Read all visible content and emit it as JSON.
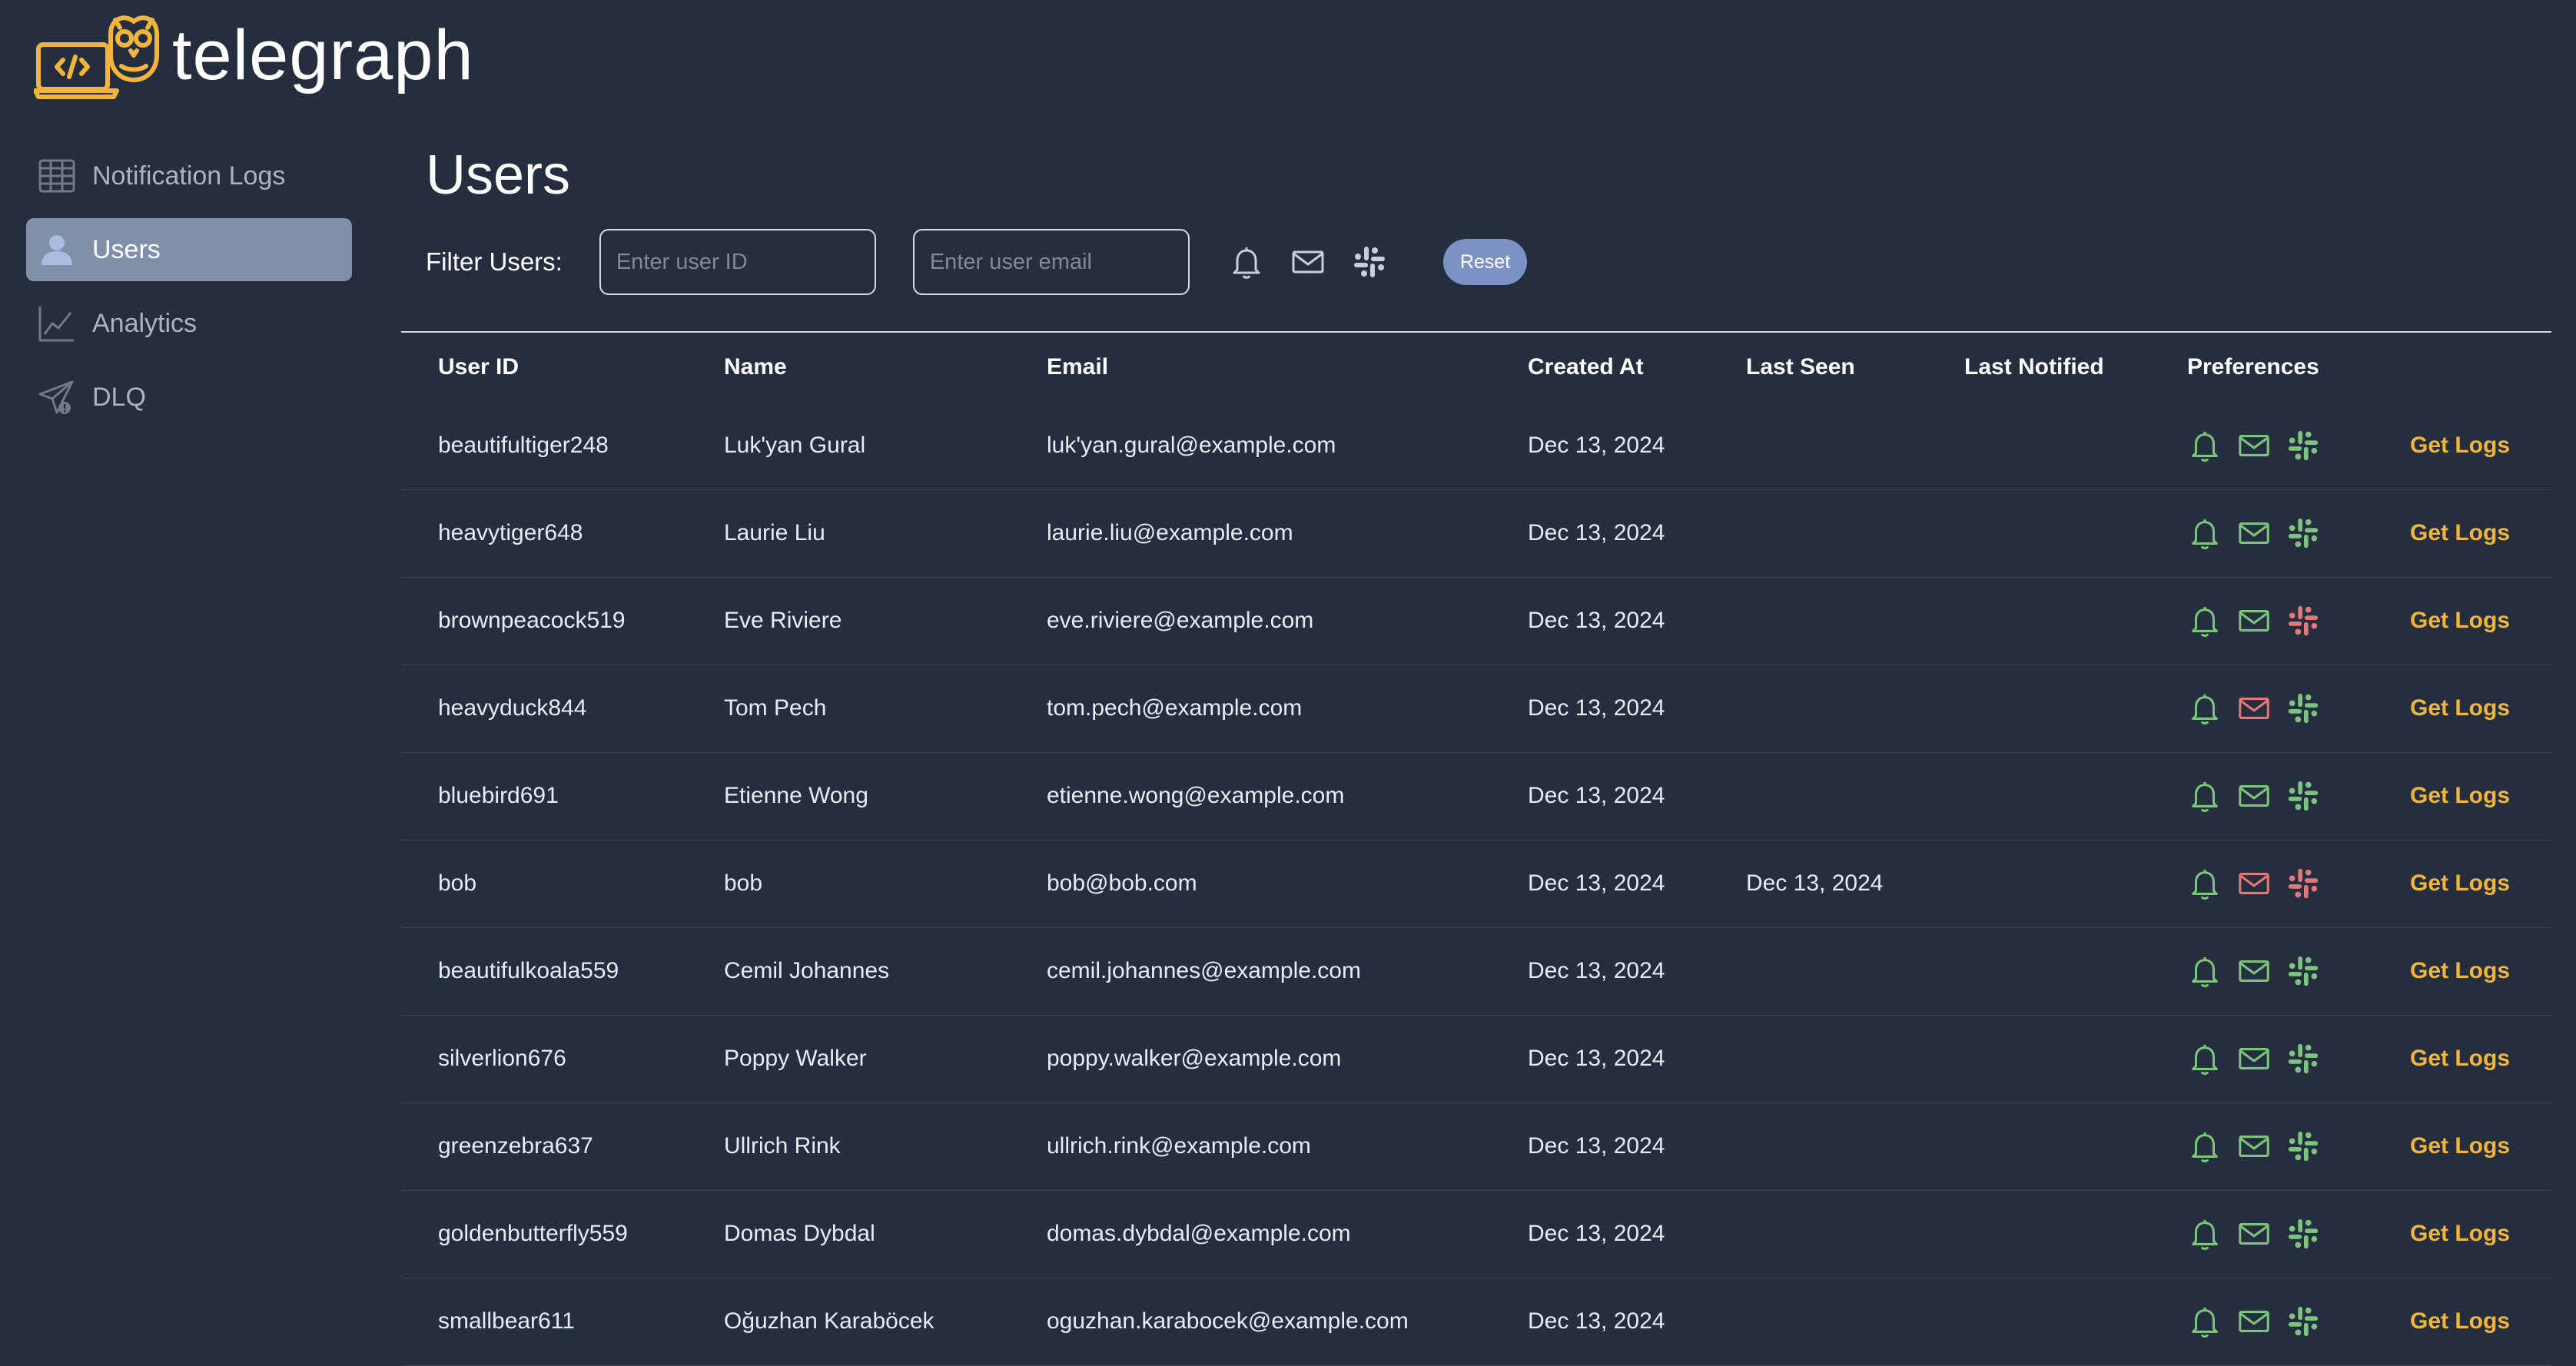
{
  "app": {
    "title": "telegraph"
  },
  "sidebar": {
    "items": [
      {
        "label": "Notification Logs",
        "icon": "table-icon"
      },
      {
        "label": "Users",
        "icon": "user-icon",
        "active": true
      },
      {
        "label": "Analytics",
        "icon": "chart-icon"
      },
      {
        "label": "DLQ",
        "icon": "paper-plane-icon"
      }
    ]
  },
  "main": {
    "title": "Users",
    "filter": {
      "label": "Filter Users:",
      "user_id_placeholder": "Enter user ID",
      "user_id_value": "",
      "email_placeholder": "Enter user email",
      "email_value": "",
      "reset_label": "Reset"
    },
    "table": {
      "columns": [
        "User ID",
        "Name",
        "Email",
        "Created At",
        "Last Seen",
        "Last Notified",
        "Preferences"
      ],
      "action_label": "Get Logs",
      "rows": [
        {
          "user_id": "beautifultiger248",
          "name": "Luk'yan Gural",
          "email": "luk'yan.gural@example.com",
          "created_at": "Dec 13, 2024",
          "last_seen": "",
          "last_notified": "",
          "prefs": {
            "in_app": true,
            "email": true,
            "slack": true
          }
        },
        {
          "user_id": "heavytiger648",
          "name": "Laurie Liu",
          "email": "laurie.liu@example.com",
          "created_at": "Dec 13, 2024",
          "last_seen": "",
          "last_notified": "",
          "prefs": {
            "in_app": true,
            "email": true,
            "slack": true
          }
        },
        {
          "user_id": "brownpeacock519",
          "name": "Eve Riviere",
          "email": "eve.riviere@example.com",
          "created_at": "Dec 13, 2024",
          "last_seen": "",
          "last_notified": "",
          "prefs": {
            "in_app": true,
            "email": true,
            "slack": false
          }
        },
        {
          "user_id": "heavyduck844",
          "name": "Tom Pech",
          "email": "tom.pech@example.com",
          "created_at": "Dec 13, 2024",
          "last_seen": "",
          "last_notified": "",
          "prefs": {
            "in_app": true,
            "email": false,
            "slack": true
          }
        },
        {
          "user_id": "bluebird691",
          "name": "Etienne Wong",
          "email": "etienne.wong@example.com",
          "created_at": "Dec 13, 2024",
          "last_seen": "",
          "last_notified": "",
          "prefs": {
            "in_app": true,
            "email": true,
            "slack": true
          }
        },
        {
          "user_id": "bob",
          "name": "bob",
          "email": "bob@bob.com",
          "created_at": "Dec 13, 2024",
          "last_seen": "Dec 13, 2024",
          "last_notified": "",
          "prefs": {
            "in_app": true,
            "email": false,
            "slack": false
          }
        },
        {
          "user_id": "beautifulkoala559",
          "name": "Cemil Johannes",
          "email": "cemil.johannes@example.com",
          "created_at": "Dec 13, 2024",
          "last_seen": "",
          "last_notified": "",
          "prefs": {
            "in_app": true,
            "email": true,
            "slack": true
          }
        },
        {
          "user_id": "silverlion676",
          "name": "Poppy Walker",
          "email": "poppy.walker@example.com",
          "created_at": "Dec 13, 2024",
          "last_seen": "",
          "last_notified": "",
          "prefs": {
            "in_app": true,
            "email": true,
            "slack": true
          }
        },
        {
          "user_id": "greenzebra637",
          "name": "Ullrich Rink",
          "email": "ullrich.rink@example.com",
          "created_at": "Dec 13, 2024",
          "last_seen": "",
          "last_notified": "",
          "prefs": {
            "in_app": true,
            "email": true,
            "slack": true
          }
        },
        {
          "user_id": "goldenbutterfly559",
          "name": "Domas Dybdal",
          "email": "domas.dybdal@example.com",
          "created_at": "Dec 13, 2024",
          "last_seen": "",
          "last_notified": "",
          "prefs": {
            "in_app": true,
            "email": true,
            "slack": true
          }
        },
        {
          "user_id": "smallbear611",
          "name": "Oğuzhan Karaböcek",
          "email": "oguzhan.karabocek@example.com",
          "created_at": "Dec 13, 2024",
          "last_seen": "",
          "last_notified": "",
          "prefs": {
            "in_app": true,
            "email": true,
            "slack": true
          }
        }
      ]
    }
  },
  "colors": {
    "background": "#252e3e",
    "accent": "#f0b53a",
    "pref_enabled": "#7cc47e",
    "pref_disabled": "#e27878",
    "reset_button": "#7b92c5",
    "active_nav": "#8090a8"
  }
}
